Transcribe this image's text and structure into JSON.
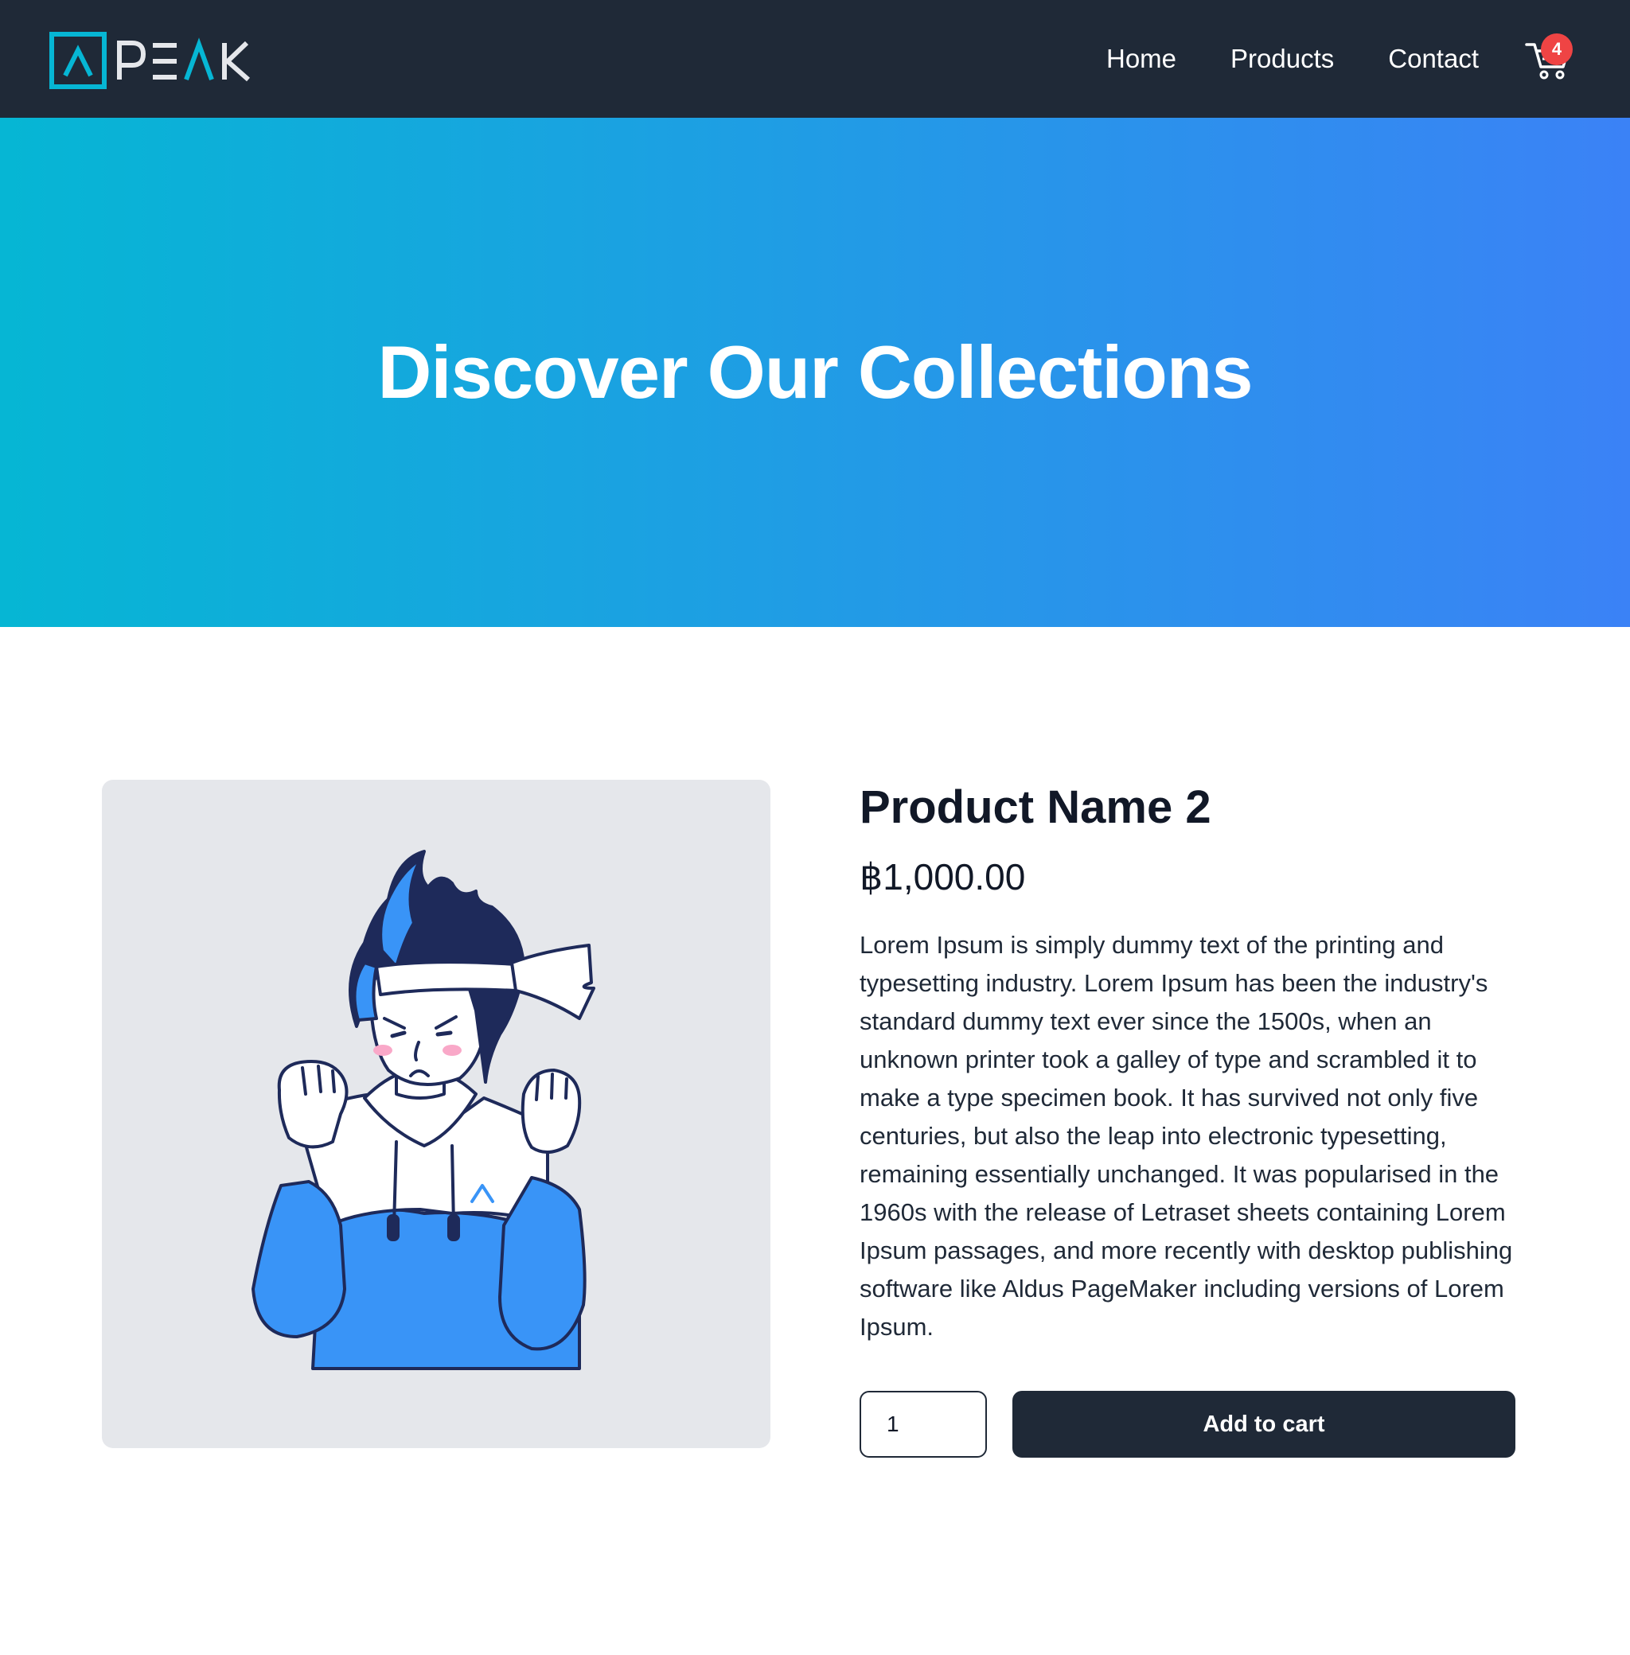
{
  "brand": {
    "logo_text": "PEAK",
    "accent_color": "#06b6d4"
  },
  "nav": {
    "links": [
      "Home",
      "Products",
      "Contact"
    ],
    "cart": {
      "icon": "cart-icon",
      "count": "4",
      "badge_color": "#ef4444"
    }
  },
  "hero": {
    "title": "Discover Our Collections",
    "gradient": [
      "#06b6d4",
      "#3b82f6"
    ]
  },
  "product": {
    "name": "Product Name 2",
    "price": "฿1,000.00",
    "description": "Lorem Ipsum is simply dummy text of the printing and typesetting industry. Lorem Ipsum has been the industry's standard dummy text ever since the 1500s, when an unknown printer took a galley of type and scrambled it to make a type specimen book. It has survived not only five centuries, but also the leap into electronic typesetting, remaining essentially unchanged. It was popularised in the 1960s with the release of Letraset sheets containing Lorem Ipsum passages, and more recently with desktop publishing software like Aldus PageMaker including versions of Lorem Ipsum.",
    "quantity": "1",
    "add_to_cart_label": "Add to cart",
    "image_icon": "character-illustration"
  }
}
